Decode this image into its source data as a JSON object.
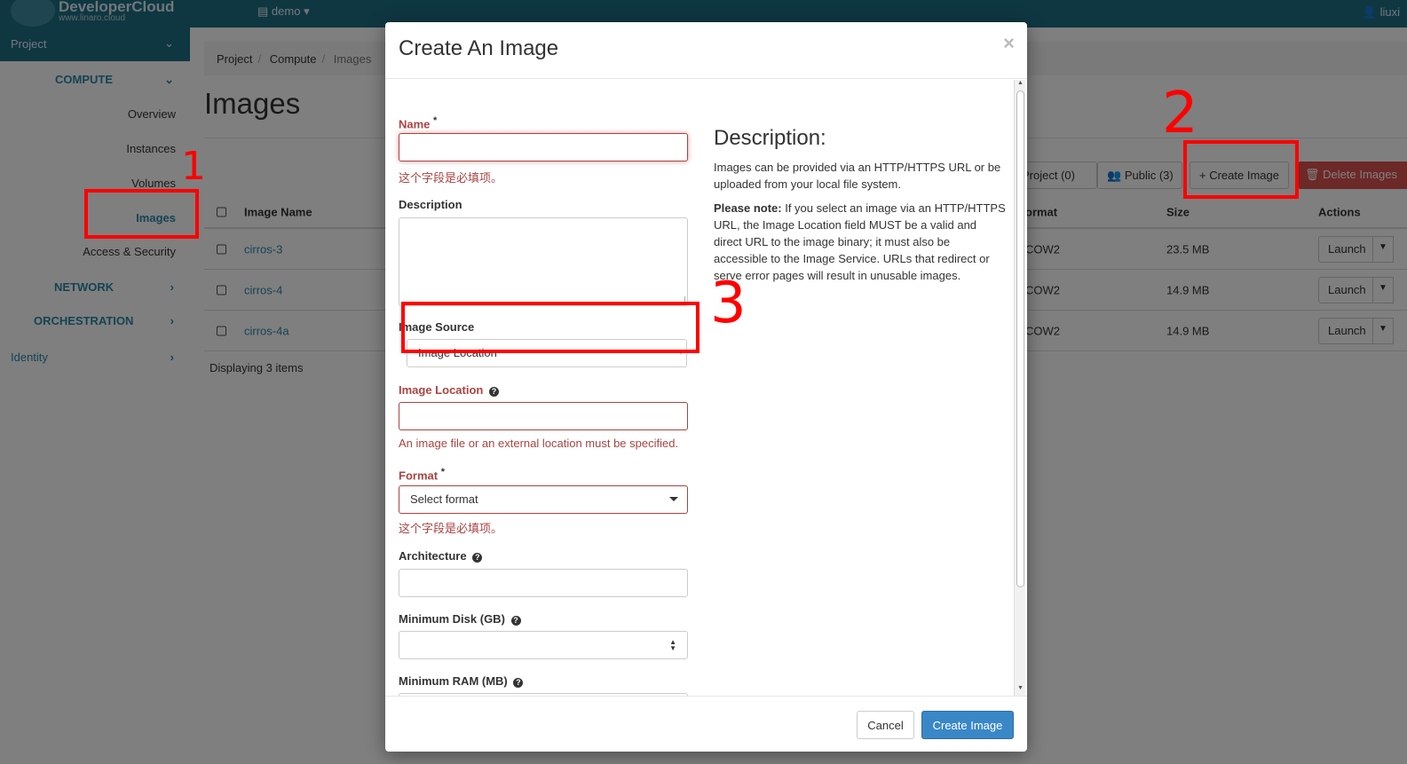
{
  "topbar": {
    "brand_name": "DeveloperCloud",
    "brand_url": "www.linaro.cloud",
    "project_label": "demo",
    "user_label": "liuxi"
  },
  "sidebar": {
    "project_label": "Project",
    "compute_label": "COMPUTE",
    "items": [
      "Overview",
      "Instances",
      "Volumes",
      "Images",
      "Access & Security"
    ],
    "network_label": "NETWORK",
    "orchestration_label": "ORCHESTRATION",
    "identity_label": "Identity"
  },
  "breadcrumb": [
    "Project",
    "Compute",
    "Images"
  ],
  "page": {
    "title": "Images",
    "filters": {
      "project": "Project (0)",
      "public": "Public (3)",
      "create": "+ Create Image",
      "delete": "Delete Images"
    },
    "table": {
      "headers": {
        "name": "Image Name",
        "format": "ormat",
        "size": "Size",
        "actions": "Actions"
      },
      "rows": [
        {
          "name": "cirros-3",
          "format": "COW2",
          "size": "23.5 MB",
          "action": "Launch"
        },
        {
          "name": "cirros-4",
          "format": "COW2",
          "size": "14.9 MB",
          "action": "Launch"
        },
        {
          "name": "cirros-4a",
          "format": "COW2",
          "size": "14.9 MB",
          "action": "Launch"
        }
      ],
      "footer": "Displaying 3 items"
    }
  },
  "annotations": {
    "one": "1",
    "two": "2",
    "three": "3"
  },
  "modal": {
    "title": "Create An Image",
    "close": "×",
    "fields": {
      "name_label": "Name",
      "required_mark": "*",
      "name_error": "这个字段是必填项。",
      "description_label": "Description",
      "image_source_label": "Image Source",
      "image_source_value": "Image Location",
      "image_location_label": "Image Location",
      "image_location_error": "An image file or an external location must be specified.",
      "format_label": "Format",
      "format_value": "Select format",
      "format_error": "这个字段是必填项。",
      "architecture_label": "Architecture",
      "min_disk_label": "Minimum Disk (GB)",
      "min_ram_label": "Minimum RAM (MB)"
    },
    "description": {
      "title": "Description:",
      "para1": "Images can be provided via an HTTP/HTTPS URL or be uploaded from your local file system.",
      "note_bold": "Please note:",
      "note_text": " If you select an image via an HTTP/HTTPS URL, the Image Location field MUST be a valid and direct URL to the image binary; it must also be accessible to the Image Service. URLs that redirect or serve error pages will result in unusable images."
    },
    "buttons": {
      "cancel": "Cancel",
      "create": "Create Image"
    }
  }
}
